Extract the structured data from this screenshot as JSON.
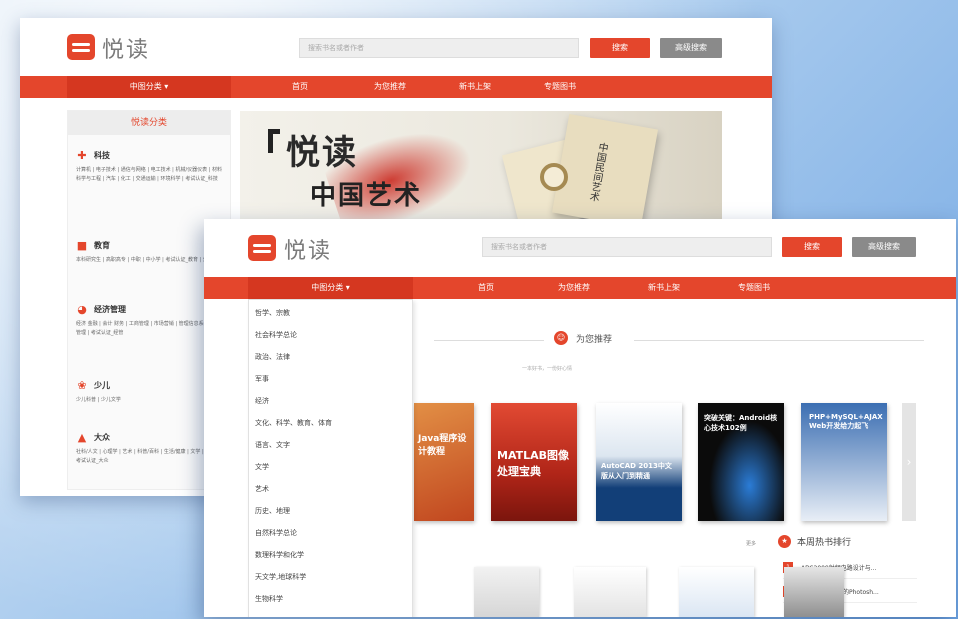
{
  "site": {
    "logo_text": "悦读",
    "search_placeholder": "搜索书名或者作者",
    "search_button": "搜索",
    "advanced_button": "高级搜索"
  },
  "nav": {
    "category": "中图分类 ▾",
    "items": [
      "首页",
      "为您推荐",
      "新书上架",
      "专题图书"
    ]
  },
  "back_window": {
    "sidebar_title": "悦读分类",
    "categories": [
      {
        "icon": "plus-icon",
        "title": "科技",
        "links": "计算机 | 电子技术 | 通信与网络 | 电工技术 | 机械/仪器仪表 | 材料科学与工程 | 汽车 | 化工 | 交通运输 | 环境科学 | 考试认证_科技"
      },
      {
        "icon": "book-icon",
        "title": "教育",
        "links": "本科研究生 | 高职高专 | 中职 | 中小学 | 考试认证_教育 | 外语教育"
      },
      {
        "icon": "pie-icon",
        "title": "经济管理",
        "links": "经济 金融 | 会计 财务 | 工商管理 | 市场营销 | 管理信息系统 | 公共管理 | 考试认证_经管"
      },
      {
        "icon": "flower-icon",
        "title": "少儿",
        "links": "少儿科普 | 少儿文学"
      },
      {
        "icon": "mountain-icon",
        "title": "大众",
        "links": "社科/人文 | 心理学 | 艺术 | 科普/百科 | 生活/健康 | 文学 | 综合 | 考试认证_大众"
      }
    ],
    "banner": {
      "title": "悦读",
      "subtitle": "中国艺术",
      "book_title": "中国民间艺术"
    }
  },
  "front_window": {
    "dropdown_items": [
      "哲学、宗教",
      "社会科学总论",
      "政治、法律",
      "军事",
      "经济",
      "文化、科学、教育、体育",
      "语言、文字",
      "文学",
      "艺术",
      "历史、地理",
      "自然科学总论",
      "数理科学和化学",
      "天文学,地球科学",
      "生物科学"
    ],
    "recommend_title": "为您推荐",
    "recommend_sub": "一本好书，一份好心情",
    "books": [
      {
        "title": "Java程序设计教程",
        "color": "#d9662c"
      },
      {
        "title": "MATLAB图像处理宝典",
        "color": "#c0392b"
      },
      {
        "title": "AutoCAD 2013中文版从入门到精通",
        "color": "#1f4f86"
      },
      {
        "title": "突破关键：Android核心技术102例",
        "color": "#1a1a1a"
      },
      {
        "title": "PHP+MySQL+AJAX Web开发给力起飞",
        "color": "#3567a8"
      }
    ],
    "more_label": "更多",
    "hot_title": "本周热书排行",
    "rankings": [
      {
        "num": "1",
        "title": "ADS2009射频电路设计与..."
      },
      {
        "num": "2",
        "title": "人人都能看得懂的Photosh..."
      }
    ]
  }
}
